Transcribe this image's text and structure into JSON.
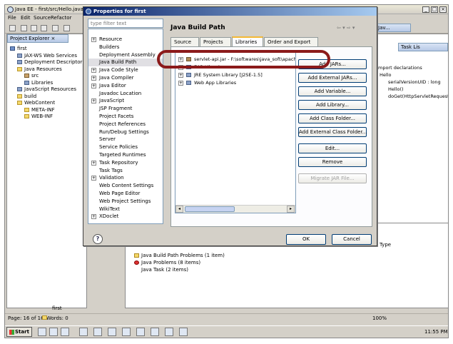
{
  "eclipse": {
    "title": "Java EE - first/src/Hello.java",
    "menu": [
      "File",
      "Edit",
      "Source",
      "Refactor"
    ],
    "project_explorer_tab": "Project Explorer",
    "tree": [
      {
        "label": "first",
        "icon": "project"
      },
      {
        "label": "JAX-WS Web Services",
        "icon": "library"
      },
      {
        "label": "Deployment Descriptor",
        "icon": "library"
      },
      {
        "label": "Java Resources",
        "icon": "folder"
      },
      {
        "label": "src",
        "icon": "package"
      },
      {
        "label": "Libraries",
        "icon": "library"
      },
      {
        "label": "JavaScript Resources",
        "icon": "library"
      },
      {
        "label": "build",
        "icon": "folder"
      },
      {
        "label": "WebContent",
        "icon": "folder"
      },
      {
        "label": "META-INF",
        "icon": "folder"
      },
      {
        "label": "WEB-INF",
        "icon": "folder"
      }
    ],
    "perspective_tab": "Jav...",
    "outline_tabs": [
      "Task Lis"
    ],
    "outline": [
      "mport declarations",
      "Hello",
      "serialVersionUID : long",
      "Hello()",
      "doGet(HttpServletRequest, H"
    ],
    "problems": {
      "col_type": "Type",
      "rows": [
        "Java Build Path Problems (1 item)",
        "Java Problems (8 items)",
        "Java Task (2 items)"
      ]
    },
    "status": {
      "page": "Page: 16 of 16",
      "words": "Words: 0",
      "selected": "first",
      "zoom": "100%"
    },
    "taskbar": {
      "start": "Start",
      "clock": "11:55 PM"
    }
  },
  "dialog": {
    "title": "Properties for first",
    "filter_placeholder": "type filter text",
    "nav": [
      {
        "label": "Resource",
        "expandable": true
      },
      {
        "label": "Builders",
        "expandable": false
      },
      {
        "label": "Deployment Assembly",
        "expandable": false
      },
      {
        "label": "Java Build Path",
        "expandable": false,
        "selected": true
      },
      {
        "label": "Java Code Style",
        "expandable": true
      },
      {
        "label": "Java Compiler",
        "expandable": true
      },
      {
        "label": "Java Editor",
        "expandable": true
      },
      {
        "label": "Javadoc Location",
        "expandable": false
      },
      {
        "label": "JavaScript",
        "expandable": true
      },
      {
        "label": "JSP Fragment",
        "expandable": false
      },
      {
        "label": "Project Facets",
        "expandable": false
      },
      {
        "label": "Project References",
        "expandable": false
      },
      {
        "label": "Run/Debug Settings",
        "expandable": false
      },
      {
        "label": "Server",
        "expandable": false
      },
      {
        "label": "Service Policies",
        "expandable": false
      },
      {
        "label": "Targeted Runtimes",
        "expandable": false
      },
      {
        "label": "Task Repository",
        "expandable": true
      },
      {
        "label": "Task Tags",
        "expandable": false
      },
      {
        "label": "Validation",
        "expandable": true
      },
      {
        "label": "Web Content Settings",
        "expandable": false
      },
      {
        "label": "Web Page Editor",
        "expandable": false
      },
      {
        "label": "Web Project Settings",
        "expandable": false
      },
      {
        "label": "WikiText",
        "expandable": false
      },
      {
        "label": "XDoclet",
        "expandable": true
      }
    ],
    "page_title": "Java Build Path",
    "tabs": [
      {
        "label": "Source"
      },
      {
        "label": "Projects"
      },
      {
        "label": "Libraries",
        "active": true
      },
      {
        "label": "Order and Export"
      }
    ],
    "libraries": [
      {
        "label": "servlet-api.jar - F:\\softwares\\java_soft\\apache-to",
        "icon": "jar"
      },
      {
        "label": "EAR Libraries",
        "icon": "library"
      },
      {
        "label": "JRE System Library [J2SE-1.5]",
        "icon": "library"
      },
      {
        "label": "Web App Libraries",
        "icon": "library"
      }
    ],
    "buttons": [
      {
        "label": "Add JARs...",
        "enabled": true
      },
      {
        "label": "Add External JARs...",
        "enabled": true
      },
      {
        "label": "Add Variable...",
        "enabled": true
      },
      {
        "label": "Add Library...",
        "enabled": true
      },
      {
        "label": "Add Class Folder...",
        "enabled": true
      },
      {
        "label": "Add External Class Folder...",
        "enabled": true
      },
      {
        "label": "Edit...",
        "enabled": true
      },
      {
        "label": "Remove",
        "enabled": true
      },
      {
        "label": "Migrate JAR File...",
        "enabled": false
      }
    ],
    "ok": "OK",
    "cancel": "Cancel",
    "help": "?"
  },
  "colors": {
    "highlight": "#8b1a1a",
    "title_bar": "#0a246a",
    "selection": "#e0dfe3"
  }
}
